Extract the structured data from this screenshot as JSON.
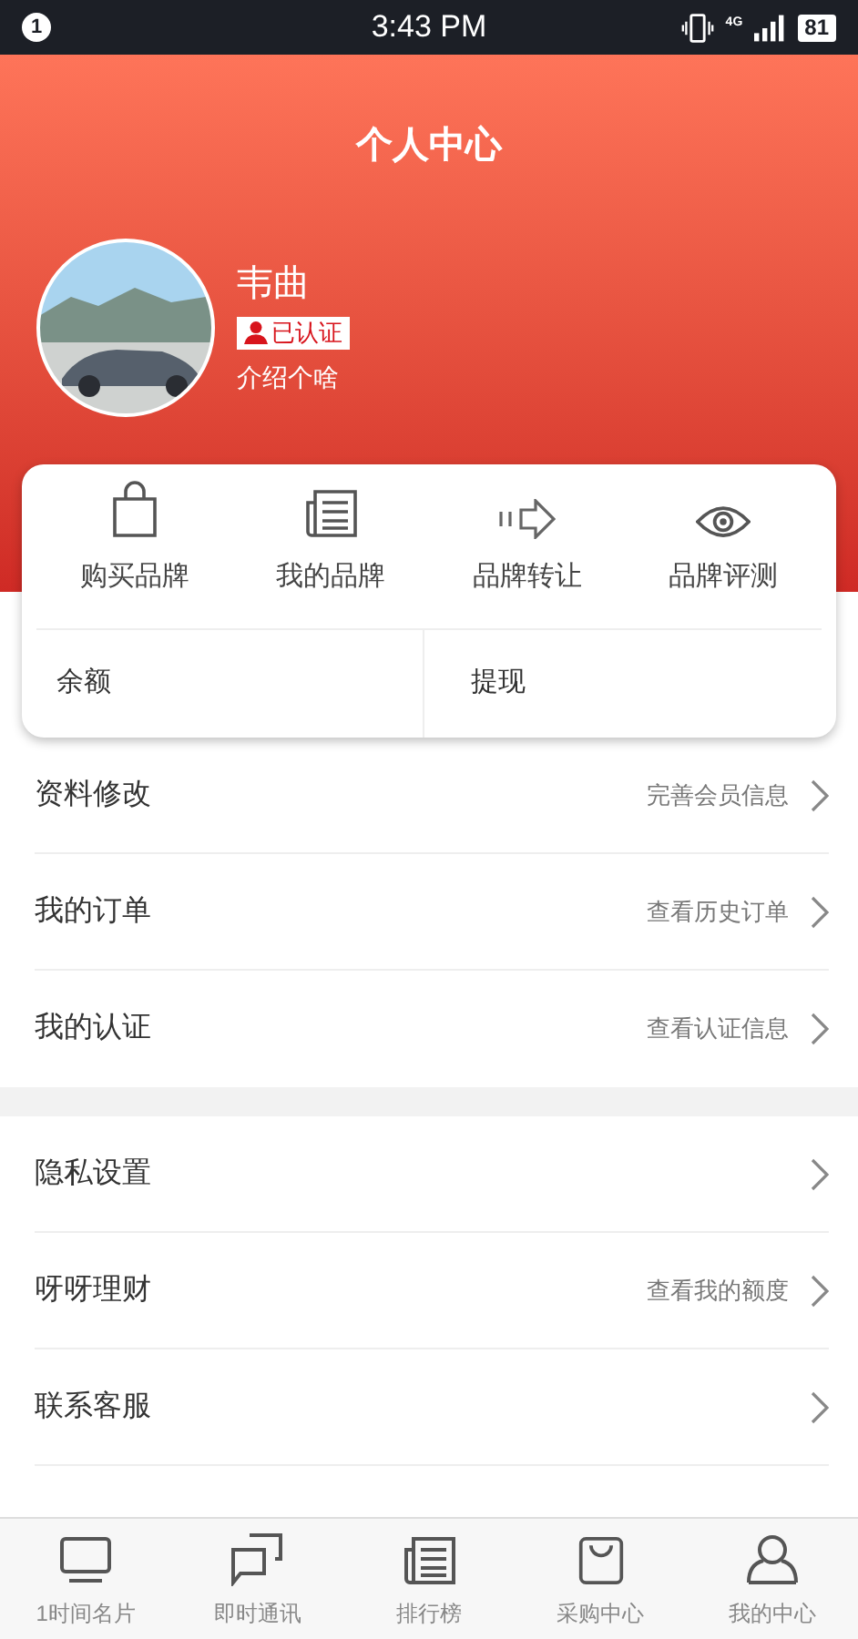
{
  "status_bar": {
    "notification_count": "1",
    "time": "3:43 PM",
    "network": "4G",
    "battery": "81"
  },
  "header": {
    "title": "个人中心"
  },
  "profile": {
    "name": "韦曲",
    "badge": "已认证",
    "bio": "介绍个啥"
  },
  "shortcuts": [
    {
      "label": "购买品牌"
    },
    {
      "label": "我的品牌"
    },
    {
      "label": "品牌转让"
    },
    {
      "label": "品牌评测"
    }
  ],
  "wallet": [
    {
      "label": "余额"
    },
    {
      "label": "提现"
    }
  ],
  "menu_groups": [
    [
      {
        "label": "资料修改",
        "hint": "完善会员信息"
      },
      {
        "label": "我的订单",
        "hint": "查看历史订单"
      },
      {
        "label": "我的认证",
        "hint": "查看认证信息"
      }
    ],
    [
      {
        "label": "隐私设置"
      },
      {
        "label": "呀呀理财",
        "hint": "查看我的额度"
      },
      {
        "label": "联系客服"
      }
    ]
  ],
  "tab_bar": [
    {
      "label": "1时间名片"
    },
    {
      "label": "即时通讯"
    },
    {
      "label": "排行榜"
    },
    {
      "label": "采购中心"
    },
    {
      "label": "我的中心"
    }
  ]
}
